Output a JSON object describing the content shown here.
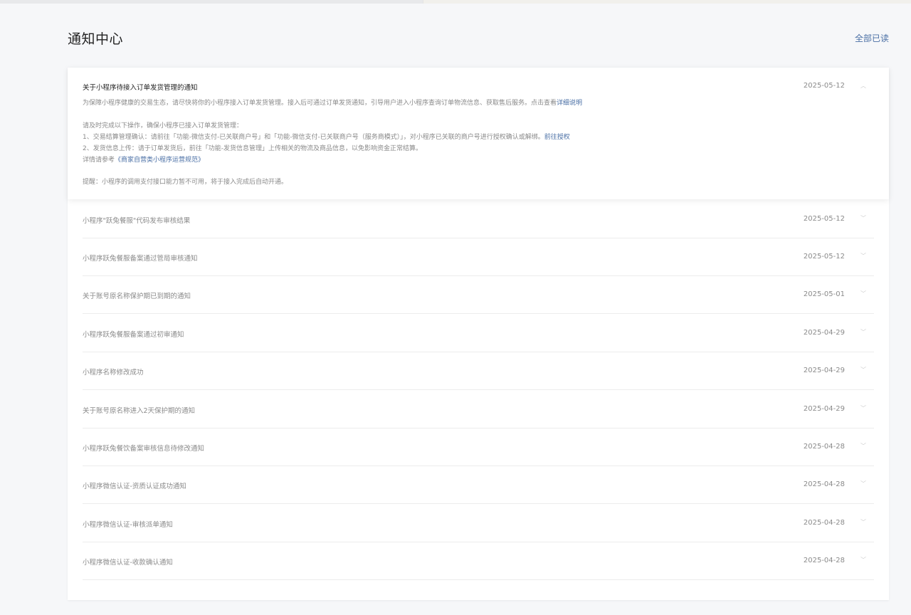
{
  "header": {
    "title": "通知中心",
    "mark_all_read": "全部已读"
  },
  "expanded": {
    "title": "关于小程序待接入订单发货管理的通知",
    "date": "2025-05-12",
    "line1": "为保障小程序健康的交易生态，请尽快将你的小程序接入订单发货管理。接入后可通过订单发货通知，引导用户进入小程序查询订单物流信息、获取售后服务。点击查看",
    "line1_link": "详细说明",
    "line2": "请及时完成以下操作，确保小程序已接入订单发货管理：",
    "line3": "1、交易结算管理确认：请前往「功能-微信支付-已关联商户号」和「功能-微信支付-已关联商户号（服务商模式）」，对小程序已关联的商户号进行授权确认或解绑。",
    "line3_link": "前往授权",
    "line4": "2、发货信息上传：请于订单发货后，前往「功能-发货信息管理」上传相关的物流及商品信息，以免影响资金正常结算。",
    "line5": "详情请参考",
    "line5_link": "《商家自营类小程序运营规范》",
    "line6": "提醒：小程序的调用支付接口能力暂不可用，将于接入完成后自动开通。"
  },
  "items": [
    {
      "title": "小程序\"跃兔餐服\"代码发布审核结果",
      "date": "2025-05-12"
    },
    {
      "title": "小程序跃兔餐服备案通过管局审核通知",
      "date": "2025-05-12"
    },
    {
      "title": "关于账号原名称保护期已到期的通知",
      "date": "2025-05-01"
    },
    {
      "title": "小程序跃兔餐服备案通过初审通知",
      "date": "2025-04-29"
    },
    {
      "title": "小程序名称修改成功",
      "date": "2025-04-29"
    },
    {
      "title": "关于账号原名称进入2天保护期的通知",
      "date": "2025-04-29"
    },
    {
      "title": "小程序跃兔餐饮备案审核信息待修改通知",
      "date": "2025-04-28"
    },
    {
      "title": "小程序微信认证-资质认证成功通知",
      "date": "2025-04-28"
    },
    {
      "title": "小程序微信认证-审核派单通知",
      "date": "2025-04-28"
    },
    {
      "title": "小程序微信认证-收款确认通知",
      "date": "2025-04-28"
    }
  ],
  "icons": {
    "chevron_up": "chevron-up-icon",
    "chevron_down": "chevron-down-icon"
  },
  "colors": {
    "link": "#4a6fa5",
    "muted_text": "#8a8a8a",
    "background": "#f6f7f9"
  }
}
